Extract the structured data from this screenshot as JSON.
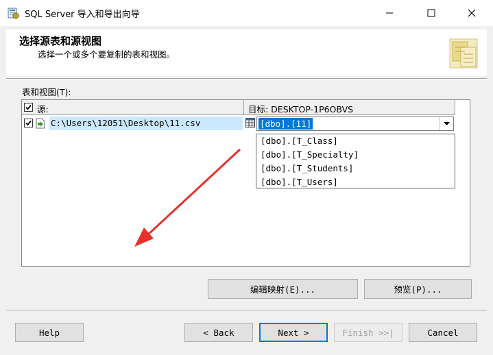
{
  "window": {
    "title": "SQL Server 导入和导出向导"
  },
  "header": {
    "title": "选择源表和源视图",
    "subtitle": "选择一个或多个要复制的表和视图。"
  },
  "tables_label": "表和视图(T):",
  "grid": {
    "col_source": "源:",
    "col_dest": "目标: DESKTOP-1P6OBVS",
    "rows": [
      {
        "source": "C:\\Users\\12051\\Desktop\\11.csv",
        "dest": "[dbo].[11]",
        "checked": true
      }
    ],
    "dropdown_options": [
      "[dbo].[T_Class]",
      "[dbo].[T_Specialty]",
      "[dbo].[T_Students]",
      "[dbo].[T_Users]"
    ]
  },
  "buttons": {
    "edit_mappings": "编辑映射(E)...",
    "preview": "预览(P)...",
    "help": "Help",
    "back": "< Back",
    "next": "Next >",
    "finish": "Finish >>|",
    "cancel": "Cancel"
  },
  "colors": {
    "accent": "#0078d7",
    "selection": "#cce8ff",
    "arrow": "#e8302a"
  }
}
